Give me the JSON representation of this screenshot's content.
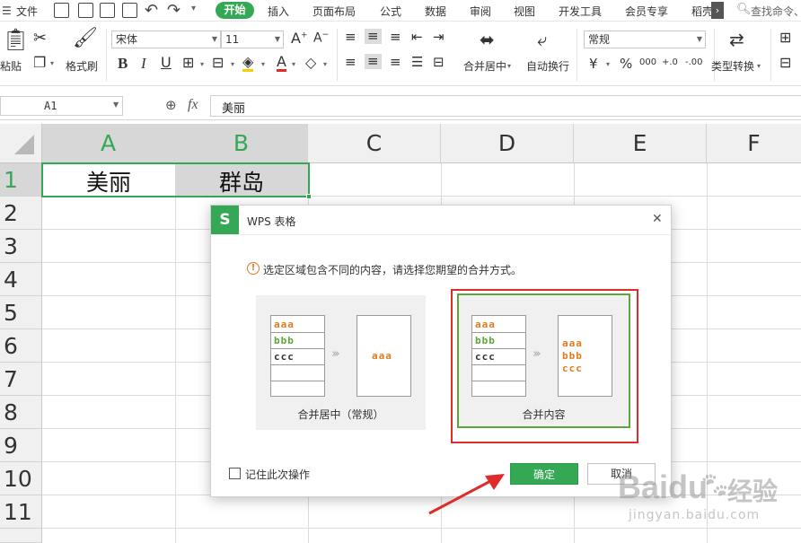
{
  "menubar": {
    "file": "文件",
    "tabs": [
      "开始",
      "插入",
      "页面布局",
      "公式",
      "数据",
      "审阅",
      "视图",
      "开发工具",
      "会员专享",
      "稻壳"
    ],
    "search": "查找命令、"
  },
  "ribbon": {
    "paste": "粘贴",
    "format_painter": "格式刷",
    "font_name": "宋体",
    "font_size": "11",
    "merge_center": "合并居中",
    "wrap_text": "自动换行",
    "number_format": "常规",
    "type_convert": "类型转换",
    "percent": "%",
    "currency": "¥",
    "thousands": "000",
    "dec_inc": "+.0",
    "dec_dec": "-.00"
  },
  "formula_bar": {
    "cell_ref": "A1",
    "fx": "fx",
    "content": "美丽"
  },
  "grid": {
    "columns": [
      "A",
      "B",
      "C",
      "D",
      "E",
      "F"
    ],
    "rows": [
      "1",
      "2",
      "3",
      "4",
      "5",
      "6",
      "7",
      "8",
      "9",
      "10",
      "11"
    ],
    "cells": {
      "A1": "美丽",
      "B1": "群岛"
    }
  },
  "dialog": {
    "logo": "S",
    "title": "WPS 表格",
    "close": "✕",
    "message": "选定区域包含不同的内容，请选择您期望的合并方式。",
    "sample_a": "aaa",
    "sample_b": "bbb",
    "sample_c": "ccc",
    "option1_label": "合并居中（常规）",
    "option2_label": "合并内容",
    "checkbox_label": "记住此次操作",
    "ok": "确定",
    "cancel": "取消"
  },
  "watermark": {
    "brand": "Baidu",
    "brand_cn": "经验",
    "url": "jingyan.baidu.com"
  },
  "colors": {
    "accent": "#35a855",
    "highlight_box": "#e02b2b",
    "sample_orange": "#e07b1f",
    "sample_green": "#5aa83a"
  }
}
